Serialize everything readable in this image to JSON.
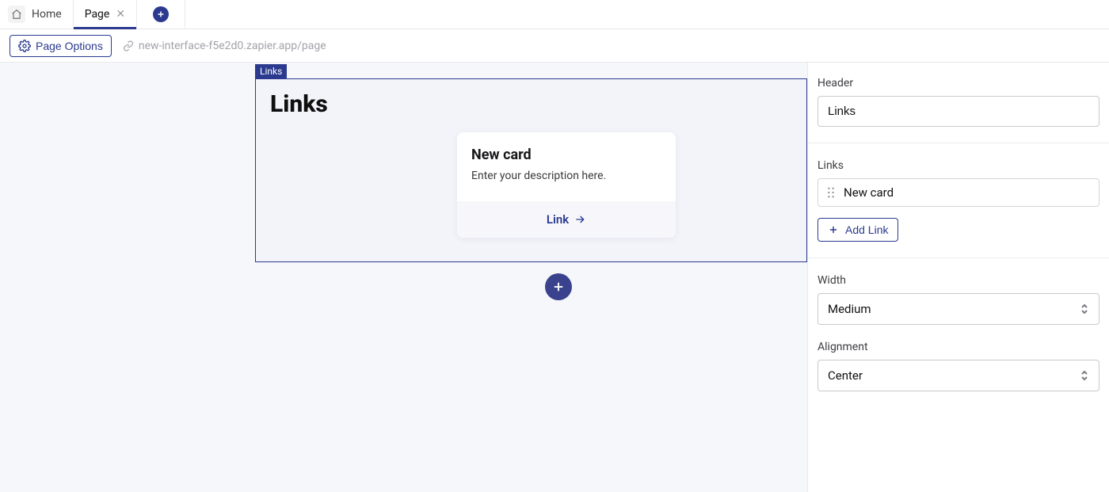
{
  "tabs": {
    "home_label": "Home",
    "page_label": "Page"
  },
  "toolbar": {
    "page_options_label": "Page Options",
    "url": "new-interface-f5e2d0.zapier.app/page"
  },
  "canvas": {
    "block_type_label": "Links",
    "heading": "Links",
    "card": {
      "title": "New card",
      "description": "Enter your description here.",
      "link_label": "Link"
    }
  },
  "inspector": {
    "header_label": "Header",
    "header_value": "Links",
    "links_label": "Links",
    "link_items": [
      {
        "label": "New card"
      }
    ],
    "add_link_label": "Add Link",
    "width_label": "Width",
    "width_value": "Medium",
    "alignment_label": "Alignment",
    "alignment_value": "Center"
  }
}
